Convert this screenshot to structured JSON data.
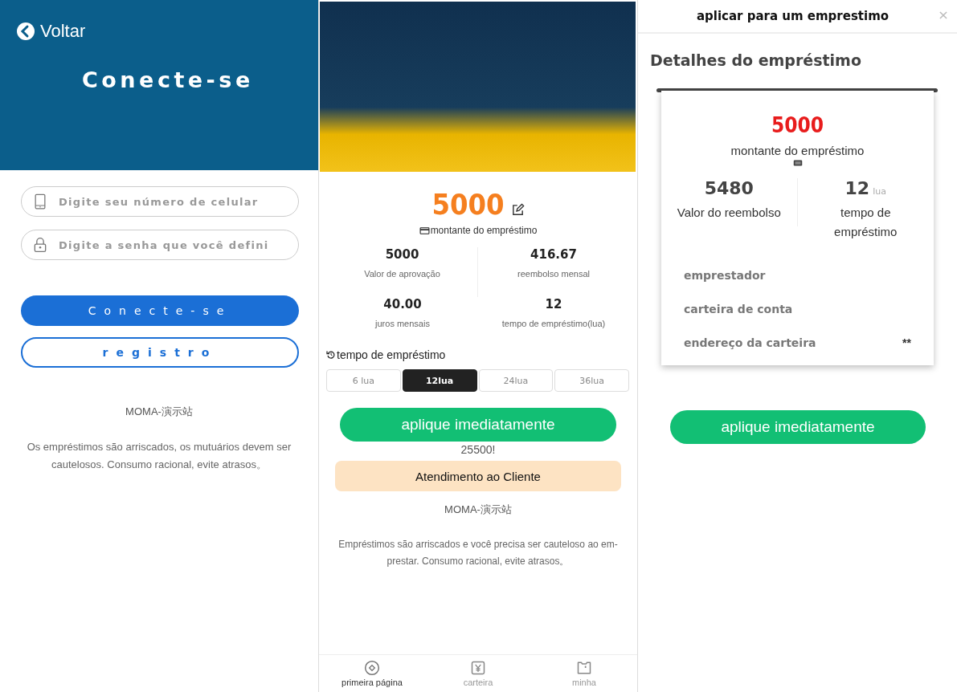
{
  "login": {
    "back_label": "Voltar",
    "title": "Conecte-se",
    "phone_field": {
      "placeholder": "Digite seu número de celular"
    },
    "password_field": {
      "placeholder": "Digite a senha que você defini"
    },
    "login_button": "Conecte-se",
    "register_button": "registro",
    "site_name": "MOMA-演示站",
    "disclaimer": "Os empréstimos são arriscados, os mutuários devem ser cautelosos. Consumo racional, evite atrasos。"
  },
  "loan": {
    "amount": "5000",
    "amount_label": "montante do empréstimo",
    "stats": [
      {
        "value": "5000",
        "label": "Valor de aprovação"
      },
      {
        "value": "416.67",
        "label": "reembolso mensal"
      },
      {
        "value": "40.00",
        "label": "juros mensais"
      },
      {
        "value": "12",
        "label": "tempo de empréstimo(lua)"
      }
    ],
    "term_heading": "tempo de empréstimo",
    "terms": [
      {
        "label": "6 lua",
        "selected": false
      },
      {
        "label": "12lua",
        "selected": true
      },
      {
        "label": "24lua",
        "selected": false
      },
      {
        "label": "36lua",
        "selected": false
      }
    ],
    "apply_button": "aplique imediatamente",
    "ticker": "25500!",
    "support_button": "Atendimento ao Cliente",
    "site_name": "MOMA-演示站",
    "disclaimer": "Empréstimos são arriscados e você precisa ser cauteloso ao em-prestar. Consumo racional, evite atrasos。",
    "nav": [
      {
        "label": "primeira página",
        "selected": true
      },
      {
        "label": "carteira",
        "selected": false
      },
      {
        "label": "minha",
        "selected": false
      }
    ]
  },
  "details": {
    "title": "aplicar para um emprestimo",
    "heading": "Detalhes do empréstimo",
    "amount": "5000",
    "amount_label": "montante do empréstimo",
    "repayment": {
      "value": "5480",
      "label": "Valor do reembolso"
    },
    "term": {
      "value": "12",
      "unit": "lua",
      "label": "tempo de empréstimo"
    },
    "fields": [
      {
        "label": "emprestador"
      },
      {
        "label": "carteira de conta"
      },
      {
        "label": "endereço da carteira",
        "value": "**"
      }
    ],
    "apply_button": "aplique imediatamente"
  }
}
